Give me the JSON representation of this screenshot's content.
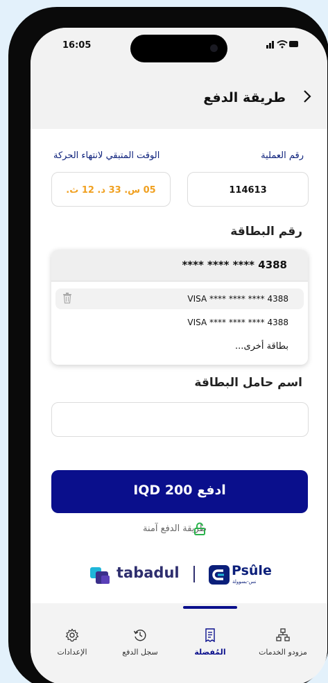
{
  "status_bar": {
    "time": "16:05",
    "icons": "..ıl ≋ ▬"
  },
  "header": {
    "title": "طريقة الدفع",
    "back_icon": "chevron-right-icon"
  },
  "transaction": {
    "number_label": "رقم العملية",
    "number_value": "114613",
    "time_label": "الوقت المتبقي لانتهاء الحركة",
    "time_value": "05 س. 33 د. 12 ث."
  },
  "card": {
    "section_title": "رقم البطاقة",
    "selected": "**** **** **** 4388",
    "options": [
      "VISA **** **** **** 4388",
      "VISA **** **** **** 4388"
    ],
    "other": "بطاقة أخرى..."
  },
  "holder": {
    "section_title": "اسم حامل البطاقة",
    "value": ""
  },
  "pay": {
    "label": "ادفع 200 IQD"
  },
  "secure": {
    "text": "طريقة الدفع آمنة"
  },
  "logos": {
    "tabadul": "tabadul",
    "psule": "Psûle",
    "psule_sub": "نس-بسوولة"
  },
  "tabs": [
    {
      "label": "مزودو الخدمات",
      "icon": "network-icon"
    },
    {
      "label": "المُفضلة",
      "icon": "receipt-icon"
    },
    {
      "label": "سجل الدفع",
      "icon": "history-icon"
    },
    {
      "label": "الإعدادات",
      "icon": "gear-icon"
    }
  ],
  "colors": {
    "primary": "#0a0f8c",
    "accent_orange": "#f0a020",
    "label_blue": "#0b1f7a",
    "background": "#e3f1fb"
  }
}
